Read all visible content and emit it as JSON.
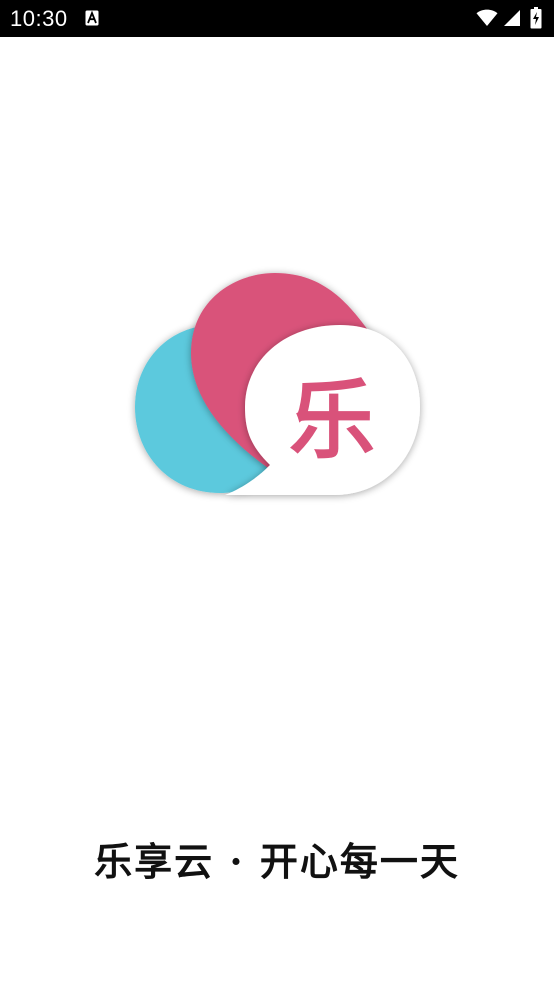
{
  "status_bar": {
    "time": "10:30",
    "icons": [
      "a-notification-icon",
      "wifi-icon",
      "cellular-signal-icon",
      "battery-charging-icon"
    ]
  },
  "logo": {
    "character": "乐",
    "colors": {
      "blue_bubble": "#5bc9dd",
      "pink_bubble": "#d9527a",
      "white_bubble": "#ffffff",
      "character": "#d9527a"
    }
  },
  "slogan": "乐享云 · 开心每一天",
  "colors": {
    "status_bar_bg": "#000000",
    "background": "#ffffff",
    "slogan_text": "#111111"
  }
}
